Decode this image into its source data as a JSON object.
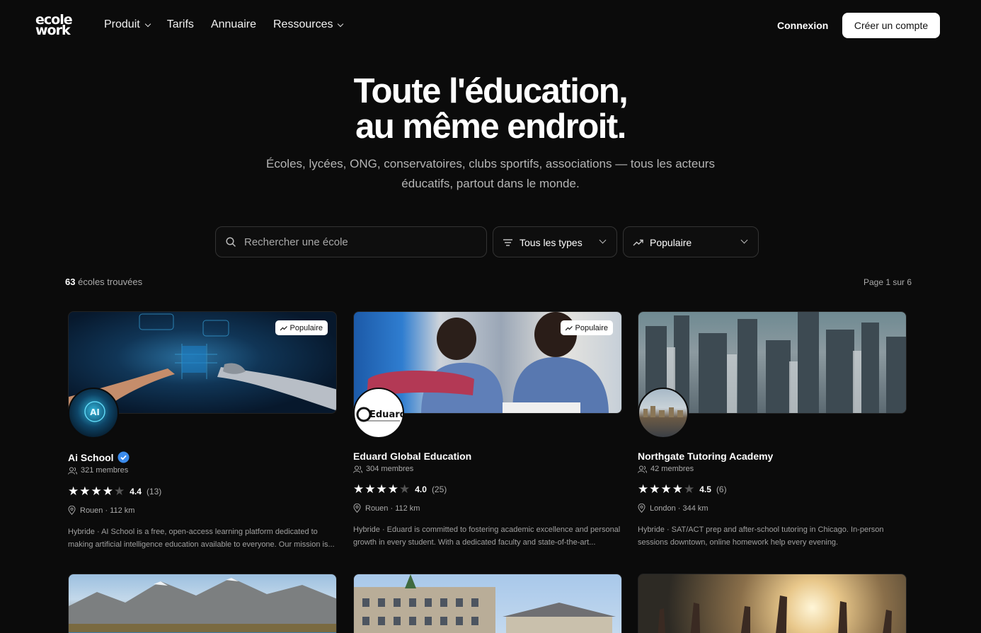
{
  "nav": {
    "logo_top": "ecole",
    "logo_bottom": "work",
    "links": [
      {
        "label": "Produit",
        "dropdown": true
      },
      {
        "label": "Tarifs",
        "dropdown": false
      },
      {
        "label": "Annuaire",
        "dropdown": false
      },
      {
        "label": "Ressources",
        "dropdown": true
      }
    ],
    "login": "Connexion",
    "signup": "Créer un compte"
  },
  "hero": {
    "title_line1": "Toute l'éducation,",
    "title_line2": "au même endroit.",
    "subtitle": "Écoles, lycées, ONG, conservatoires, clubs sportifs, associations — tous les acteurs éducatifs, partout dans le monde."
  },
  "filters": {
    "search_placeholder": "Rechercher une école",
    "search_value": "",
    "type_selected": "Tous les types",
    "sort_selected": "Populaire"
  },
  "results": {
    "count": "63",
    "count_label": "écoles trouvées",
    "page_info": "Page 1 sur 6"
  },
  "cards": [
    {
      "name": "Ai School",
      "verified": true,
      "badge": "Populaire",
      "members": "321 membres",
      "rating": "4.4",
      "stars": 4,
      "reviews": "(13)",
      "location": "Rouen · 112 km",
      "description": "Hybride · AI School is a free, open-access learning platform dedicated to making artificial intelligence education available to everyone. Our mission is..."
    },
    {
      "name": "Eduard Global Education",
      "verified": false,
      "badge": "Populaire",
      "members": "304 membres",
      "rating": "4.0",
      "stars": 4,
      "reviews": "(25)",
      "location": "Rouen · 112 km",
      "description": "Hybride · Eduard is committed to fostering academic excellence and personal growth in every student. With a dedicated faculty and state-of-the-art...",
      "avatar_text": "Eduard"
    },
    {
      "name": "Northgate Tutoring Academy",
      "verified": false,
      "badge": "",
      "members": "42 membres",
      "rating": "4.5",
      "stars": 4,
      "reviews": "(6)",
      "location": "London · 344 km",
      "description": "Hybride · SAT/ACT prep and after-school tutoring in Chicago. In-person sessions downtown, online homework help every evening."
    }
  ]
}
